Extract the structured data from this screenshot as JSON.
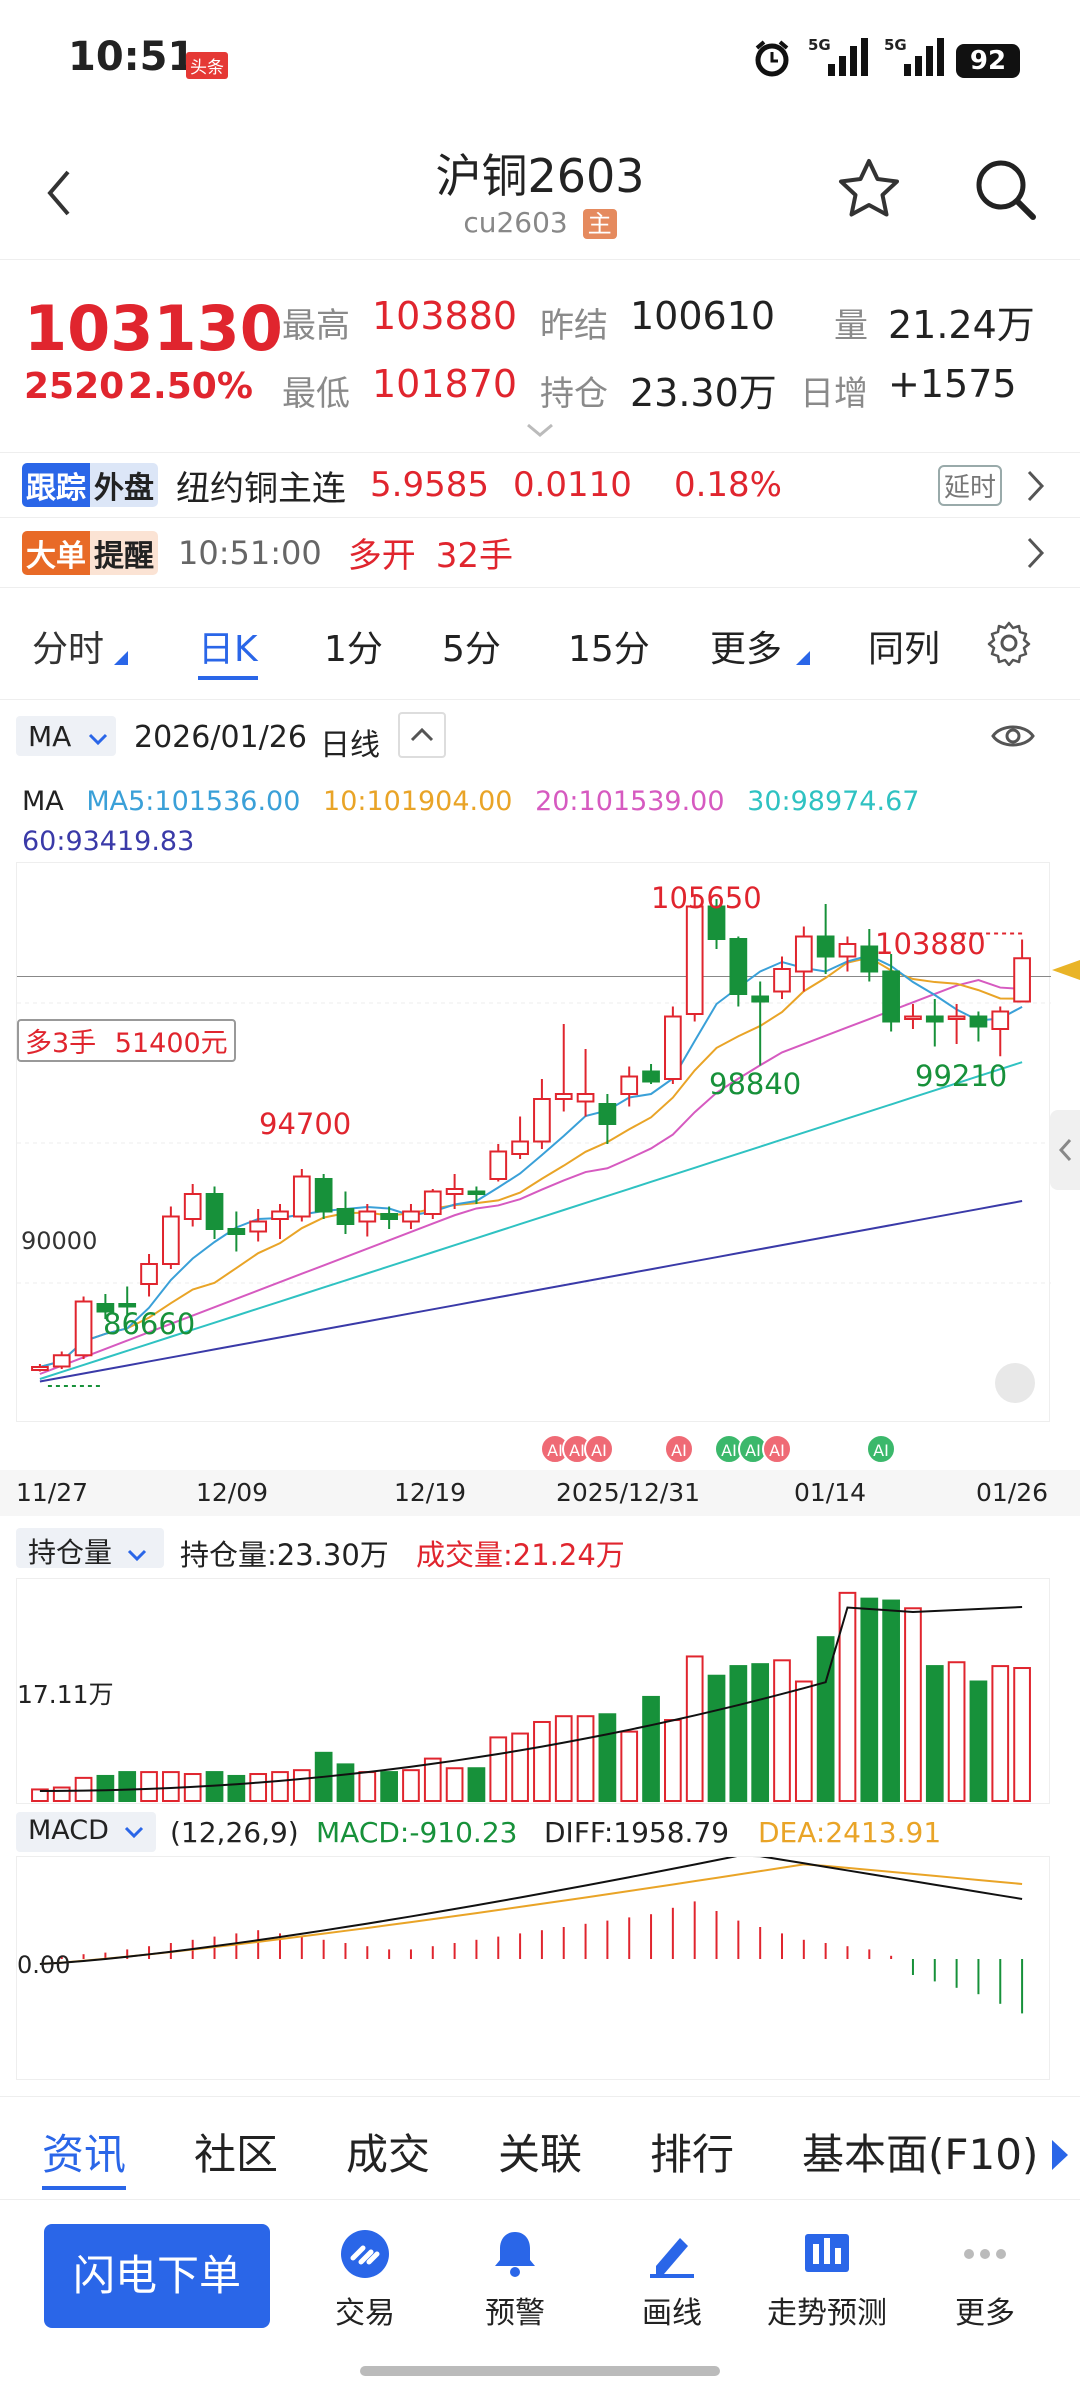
{
  "status": {
    "time": "10:51",
    "app_tag": "头条",
    "network_1": "5G",
    "network_2": "5G",
    "battery": "92"
  },
  "header": {
    "title": "沪铜2603",
    "code": "cu2603",
    "badge": "主"
  },
  "quote": {
    "price": "103130",
    "change": "2520",
    "change_pct": "2.50%",
    "high_label": "最高",
    "high": "103880",
    "low_label": "最低",
    "low": "101870",
    "prev_settle_label": "昨结",
    "prev_settle": "100610",
    "open_int_label": "持仓",
    "open_int": "23.30万",
    "volume_label": "量",
    "volume": "21.24万",
    "daily_inc_label": "日增",
    "daily_inc": "+1575"
  },
  "outer": {
    "tag_a": "跟踪",
    "tag_b": "外盘",
    "name": "纽约铜主连",
    "price": "5.9585",
    "change": "0.0110",
    "pct": "0.18%",
    "delay": "延时"
  },
  "alert": {
    "tag_a": "大单",
    "tag_b": "提醒",
    "time": "10:51:00",
    "action": "多开",
    "qty": "32手"
  },
  "tabs": [
    "分时",
    "日K",
    "1分",
    "5分",
    "15分",
    "更多",
    "同列"
  ],
  "chart_bar": {
    "indicator": "MA",
    "date": "2026/01/26",
    "period": "日线"
  },
  "ma_legend": {
    "title": "MA",
    "ma5": "MA5:101536.00",
    "ma10": "10:101904.00",
    "ma20": "20:101539.00",
    "ma30": "30:98974.67",
    "ma60": "60:93419.83"
  },
  "chart_labels": {
    "high_all": "105650",
    "high_recent": "103880",
    "mid_high": "94700",
    "low_first": "86660",
    "low_a": "98840",
    "low_b": "99210",
    "axis_90000": "90000",
    "position_tag": "多3手",
    "position_value": "51400元"
  },
  "ai_badge": "AI",
  "dates": [
    "11/27",
    "12/09",
    "12/19",
    "2025/12/31",
    "01/14",
    "01/26"
  ],
  "vol_panel": {
    "selector": "持仓量",
    "open_int_text": "持仓量:23.30万",
    "vol_text": "成交量:21.24万",
    "axis": "17.11万"
  },
  "macd_panel": {
    "selector": "MACD",
    "params": "(12,26,9)",
    "macd": "MACD:-910.23",
    "diff": "DIFF:1958.79",
    "dea": "DEA:2413.91",
    "zero": "0.00"
  },
  "bottom_tabs": [
    "资讯",
    "社区",
    "成交",
    "关联",
    "排行",
    "基本面(F10)"
  ],
  "actions": {
    "order": "闪电下单",
    "trade": "交易",
    "warn": "预警",
    "draw": "画线",
    "predict": "走势预测",
    "more": "更多"
  },
  "colors": {
    "up": "#e0252e",
    "down": "#17913a",
    "accent": "#2a66e8",
    "ma5": "#3aa0d8",
    "ma10": "#e9a427",
    "ma20": "#d65ac0",
    "ma30": "#2fc2c2",
    "ma60": "#3a3aa8"
  },
  "chart_data": {
    "type": "candlestick",
    "candles": [
      [
        86660,
        86900,
        86600,
        86780
      ],
      [
        86800,
        87400,
        86700,
        87250
      ],
      [
        87250,
        89600,
        87100,
        89400
      ],
      [
        89300,
        89700,
        88700,
        89000
      ],
      [
        89300,
        90000,
        88800,
        89200
      ],
      [
        90100,
        91300,
        89600,
        90900
      ],
      [
        90900,
        93200,
        90700,
        92800
      ],
      [
        92700,
        94100,
        92400,
        93700
      ],
      [
        93700,
        94000,
        91900,
        92300
      ],
      [
        92300,
        93000,
        91400,
        92100
      ],
      [
        92200,
        93100,
        91800,
        92600
      ],
      [
        92700,
        93300,
        91900,
        93000
      ],
      [
        92800,
        94700,
        92600,
        94400
      ],
      [
        94300,
        94500,
        92700,
        93000
      ],
      [
        93100,
        93800,
        92100,
        92500
      ],
      [
        92600,
        93300,
        92000,
        93000
      ],
      [
        92900,
        93200,
        92300,
        92700
      ],
      [
        92600,
        93300,
        92300,
        93000
      ],
      [
        92900,
        93900,
        92700,
        93800
      ],
      [
        93700,
        94500,
        93100,
        93900
      ],
      [
        93800,
        94000,
        93300,
        93700
      ],
      [
        94300,
        95700,
        94200,
        95400
      ],
      [
        95300,
        96800,
        95100,
        95800
      ],
      [
        95800,
        98300,
        95500,
        97500
      ],
      [
        97500,
        100500,
        97000,
        97700
      ],
      [
        97400,
        99500,
        96800,
        97700
      ],
      [
        97300,
        97700,
        95700,
        96500
      ],
      [
        97700,
        98800,
        97200,
        98400
      ],
      [
        98600,
        98900,
        98100,
        98200
      ],
      [
        98300,
        101200,
        98100,
        100800
      ],
      [
        100900,
        105650,
        100600,
        105200
      ],
      [
        105200,
        105500,
        103500,
        103900
      ],
      [
        103900,
        104000,
        101200,
        101700
      ],
      [
        101600,
        102200,
        98840,
        101400
      ],
      [
        101800,
        103200,
        101500,
        102700
      ],
      [
        102600,
        104400,
        101800,
        104000
      ],
      [
        104000,
        105300,
        102500,
        103200
      ],
      [
        103200,
        104000,
        102600,
        103700
      ],
      [
        103600,
        104300,
        102200,
        102600
      ],
      [
        102600,
        103300,
        100200,
        100600
      ],
      [
        100700,
        101300,
        100300,
        100800
      ],
      [
        100800,
        101500,
        99600,
        100600
      ],
      [
        100700,
        101300,
        99700,
        100800
      ],
      [
        100800,
        101000,
        99800,
        100400
      ],
      [
        100300,
        101200,
        99210,
        101000
      ],
      [
        101400,
        103880,
        101400,
        103130
      ]
    ],
    "xlabels": [
      "11/27",
      "12/09",
      "12/19",
      "2025/12/31",
      "01/14",
      "01/26"
    ]
  }
}
